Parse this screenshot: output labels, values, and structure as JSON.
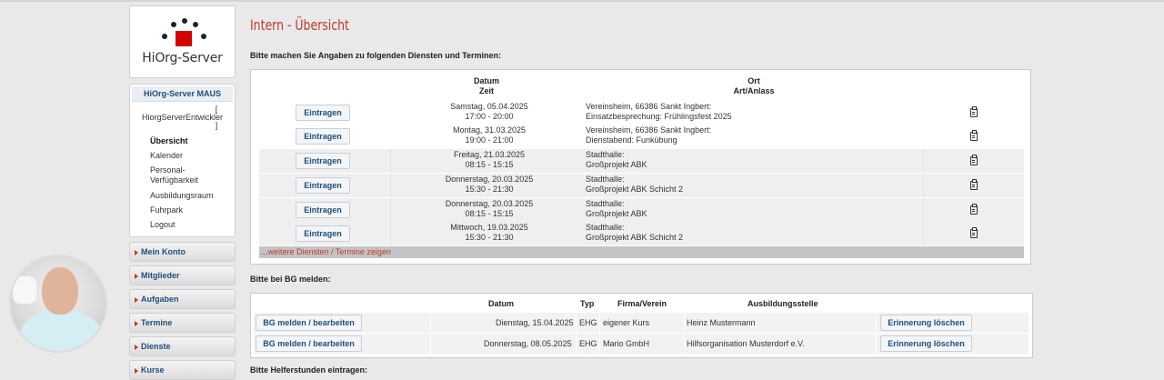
{
  "sidebar": {
    "logo_text": "HiOrg-Server",
    "org_title": "HiOrg-Server MAUS",
    "dev_open": "[",
    "dev_name": "HiorgServerEntwickler",
    "dev_close": "]",
    "nav": [
      "Übersicht",
      "Kalender",
      "Personal-Verfügbarkeit",
      "Ausbildungsraum",
      "Fuhrpark",
      "Logout"
    ],
    "nav_active": "Übersicht",
    "sections": [
      "Mein Konto",
      "Mitglieder",
      "Aufgaben",
      "Termine",
      "Dienste",
      "Kurse"
    ]
  },
  "page": {
    "title": "Intern - Übersicht",
    "section1_title": "Bitte machen Sie Angaben zu folgenden Diensten und Terminen:",
    "section2_title": "Bitte bei BG melden:",
    "section3_title": "Bitte Helferstunden eintragen:"
  },
  "duties": {
    "headers": {
      "datum": "Datum",
      "zeit": "Zeit",
      "ort": "Ort",
      "anlass": "Art/Anlass"
    },
    "button_label": "Eintragen",
    "rows": [
      {
        "date": "Samstag, 05.04.2025",
        "time": "17:00 - 20:00",
        "ort": "Vereinsheim, 66386 Sankt Ingbert:",
        "anlass": "Einsatzbesprechung: Frühlingsfest 2025"
      },
      {
        "date": "Montag, 31.03.2025",
        "time": "19:00 - 21:00",
        "ort": "Vereinsheim, 66386 Sankt Ingbert:",
        "anlass": "Dienstabend: Funkübung"
      },
      {
        "date": "Freitag, 21.03.2025",
        "time": "08:15 - 15:15",
        "ort": "Stadthalle:",
        "anlass": "Großprojekt ABK"
      },
      {
        "date": "Donnerstag, 20.03.2025",
        "time": "15:30 - 21:30",
        "ort": "Stadthalle:",
        "anlass": "Großprojekt ABK Schicht 2"
      },
      {
        "date": "Donnerstag, 20.03.2025",
        "time": "08:15 - 15:15",
        "ort": "Stadthalle:",
        "anlass": "Großprojekt ABK"
      },
      {
        "date": "Mittwoch, 19.03.2025",
        "time": "15:30 - 21:30",
        "ort": "Stadthalle:",
        "anlass": "Großprojekt ABK Schicht 2"
      }
    ],
    "more_link": "...weitere Diensten / Termine zeigen"
  },
  "bg": {
    "headers": {
      "datum": "Datum",
      "typ": "Typ",
      "firma": "Firma/Verein",
      "stelle": "Ausbildungsstelle"
    },
    "button_label": "BG melden / bearbeiten",
    "delete_label": "Erinnerung löschen",
    "rows": [
      {
        "date": "Dienstag, 15.04.2025",
        "typ": "EHG",
        "firma": "eigener Kurs",
        "stelle": "Heinz Mustermann"
      },
      {
        "date": "Donnerstag, 08.05.2025",
        "typ": "EHG",
        "firma": "Mario GmbH",
        "stelle": "Hilfsorganisation Musterdorf e.V."
      }
    ]
  },
  "colors": {
    "accent_red": "#c0392b",
    "link_blue": "#1f4e79",
    "logo_red": "#d40000"
  }
}
